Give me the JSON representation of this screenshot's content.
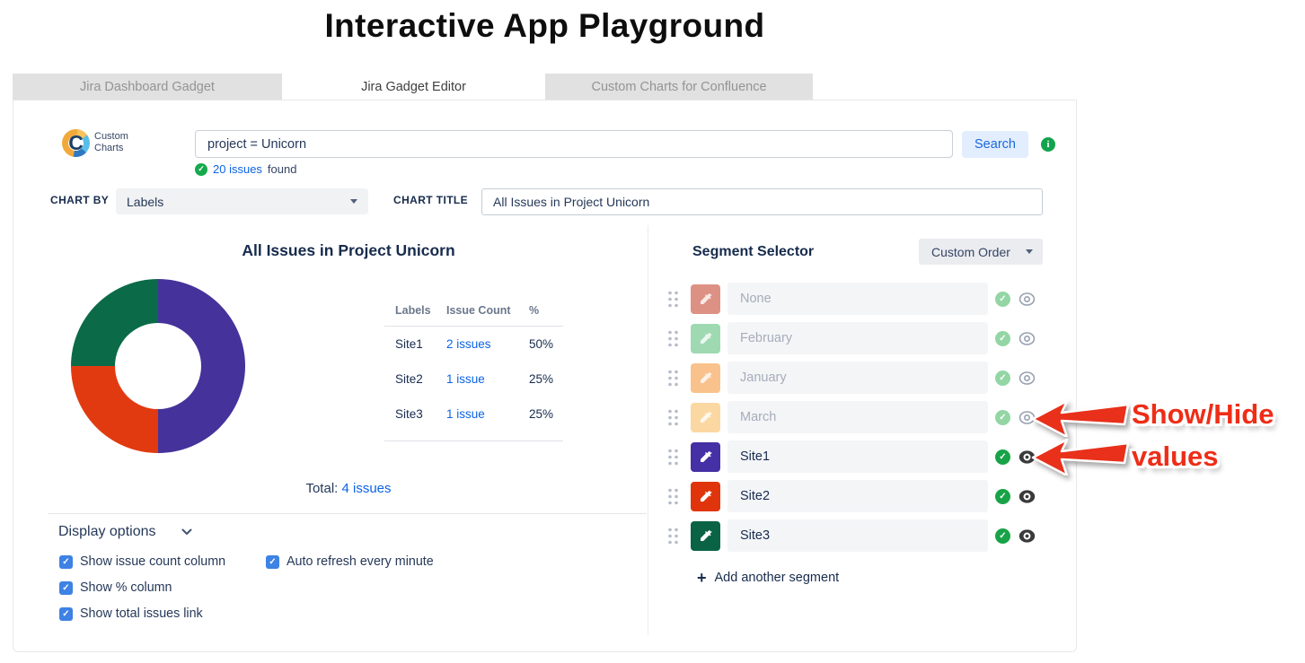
{
  "page": {
    "title": "Interactive App Playground"
  },
  "tabs": [
    {
      "label": "Jira Dashboard Gadget",
      "active": false
    },
    {
      "label": "Jira Gadget Editor",
      "active": true
    },
    {
      "label": "Custom Charts for Confluence",
      "active": false
    }
  ],
  "toolbar": {
    "logo": {
      "line1": "Custom",
      "line2": "Charts",
      "letter": "C"
    },
    "jql_value": "project = Unicorn",
    "search_label": "Search",
    "results": {
      "link": "20 issues",
      "suffix": "found"
    }
  },
  "controls": {
    "chart_by_label": "CHART BY",
    "chart_by_value": "Labels",
    "chart_title_label": "CHART TITLE",
    "chart_title_value": "All Issues in Project Unicorn"
  },
  "chart_data": {
    "type": "pie",
    "donut": true,
    "title": "All Issues in Project Unicorn",
    "categories": [
      "Site1",
      "Site2",
      "Site3"
    ],
    "values": [
      2,
      1,
      1
    ],
    "percentages": [
      50,
      25,
      25
    ],
    "colors": [
      "#45329B",
      "#E23A10",
      "#0B6B48"
    ],
    "legend_position": "right",
    "legend_headers": {
      "label": "Labels",
      "count": "Issue Count",
      "pct": "%"
    },
    "rows": [
      {
        "label": "Site1",
        "count_link": "2 issues",
        "pct": "50%",
        "color": "#45329B"
      },
      {
        "label": "Site2",
        "count_link": "1 issue",
        "pct": "25%",
        "color": "#E23A10"
      },
      {
        "label": "Site3",
        "count_link": "1 issue",
        "pct": "25%",
        "color": "#0B6B48"
      }
    ],
    "total_prefix": "Total:",
    "total_link": "4 issues"
  },
  "display_options": {
    "title": "Display options",
    "checkboxes": [
      {
        "label": "Show issue count column",
        "checked": true
      },
      {
        "label": "Show % column",
        "checked": true
      },
      {
        "label": "Show total issues link",
        "checked": true
      },
      {
        "label": "Auto refresh every minute",
        "checked": true
      }
    ]
  },
  "segment_selector": {
    "title": "Segment Selector",
    "order_value": "Custom Order",
    "rows": [
      {
        "name": "None",
        "color": "#DD9184",
        "state": "hidden"
      },
      {
        "name": "February",
        "color": "#9ED9B2",
        "state": "hidden"
      },
      {
        "name": "January",
        "color": "#F9C28C",
        "state": "hidden"
      },
      {
        "name": "March",
        "color": "#FBD8A2",
        "state": "hidden"
      },
      {
        "name": "Site1",
        "color": "#4630A5",
        "state": "shown"
      },
      {
        "name": "Site2",
        "color": "#E0350C",
        "state": "shown"
      },
      {
        "name": "Site3",
        "color": "#0B6345",
        "state": "shown"
      }
    ],
    "add_label": "Add another segment"
  },
  "annotation": {
    "line1": "Show/Hide",
    "line2": "values"
  },
  "theme": {
    "link_blue": "#0C63E4",
    "check_green": "#18A348",
    "annotation_red": "#EE2D17"
  }
}
